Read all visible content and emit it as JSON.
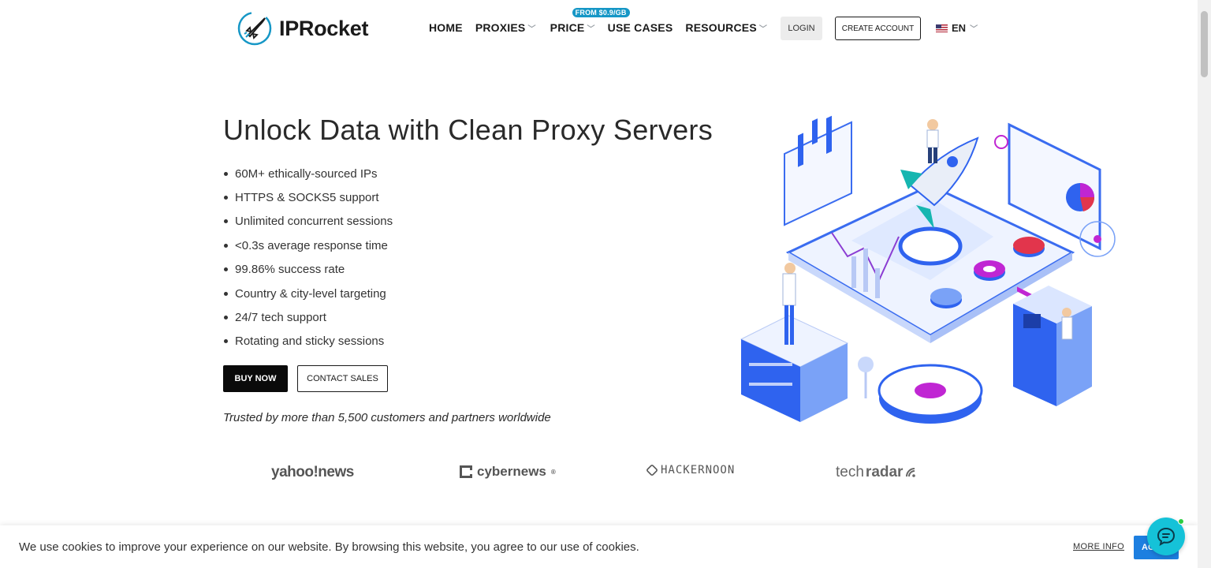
{
  "header": {
    "logo_text": "IPRocket",
    "nav": {
      "home": "HOME",
      "proxies": "PROXIES",
      "price": "PRICE",
      "price_badge": "FROM $0.9/GB",
      "use_cases": "USE CASES",
      "resources": "RESOURCES"
    },
    "login_label": "LOGIN",
    "create_account_label": "CREATE ACCOUNT",
    "language": "EN"
  },
  "hero": {
    "title": "Unlock Data with Clean Proxy Servers",
    "features": [
      "60M+ ethically-sourced IPs",
      "HTTPS & SOCKS5 support",
      "Unlimited concurrent sessions",
      "<0.3s average response time",
      "99.86% success rate",
      "Country & city-level targeting",
      "24/7 tech support",
      "Rotating and sticky sessions"
    ],
    "buy_now_label": "BUY NOW",
    "contact_sales_label": "CONTACT SALES",
    "trusted_text": "Trusted by more than 5,500 customers and partners worldwide"
  },
  "press": {
    "yahoo": "yahoo!news",
    "cybernews": "cybernews",
    "cybernews_mark": "®",
    "hackernoon": "HACKERNOON",
    "techradar_light": "tech",
    "techradar_bold": "radar"
  },
  "cookie": {
    "text": "We use cookies to improve your experience on our website. By browsing this website, you agree to our use of cookies.",
    "more_info_label": "MORE INFO",
    "accept_label": "AC"
  },
  "colors": {
    "brand_blue": "#1d7fe0",
    "badge_blue": "#1697c6",
    "chat_teal": "#15c2d8",
    "accent_magenta": "#c026d3"
  }
}
